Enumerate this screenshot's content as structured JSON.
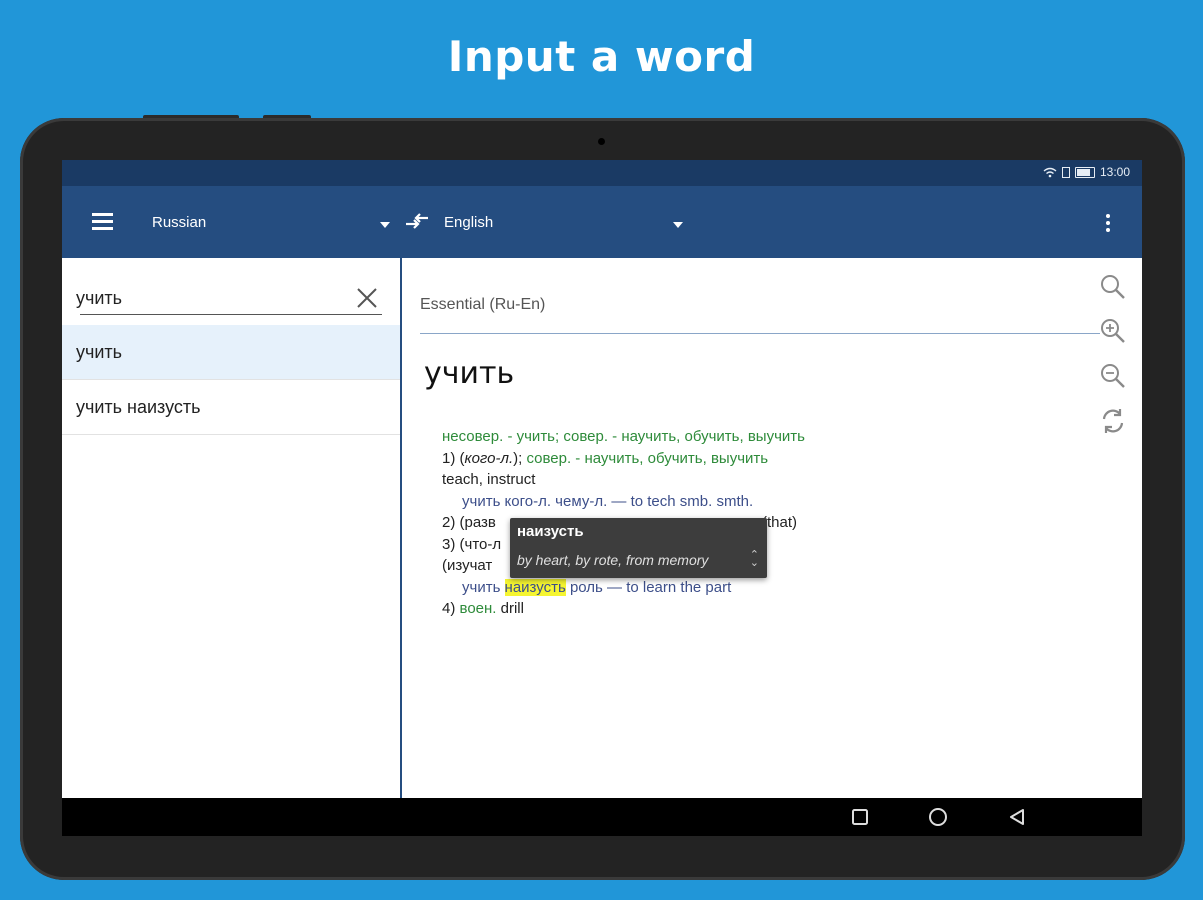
{
  "headline": "Input a word",
  "status": {
    "time": "13:00"
  },
  "toolbar": {
    "source_language": "Russian",
    "target_language": "English"
  },
  "search": {
    "query": "учить"
  },
  "suggestions": [
    {
      "label": "учить"
    },
    {
      "label": "учить наизусть"
    }
  ],
  "dictionary": {
    "name": "Essential (Ru-En)",
    "headword": "учить",
    "entry_lines": {
      "grammar": "несовер. - учить; совер. - научить, обучить, выучить",
      "s1_num": "1) (",
      "s1_obj": "кого-л.",
      "s1_close": ");",
      "s1_green": " совер. - научить, обучить, выучить",
      "s1_trans": "teach, instruct",
      "s1_ex": "учить кого-л. чему-л. — to tech smb. smth.",
      "s2_a": "2) (разв",
      "s2_b": "(that)",
      "s3_a": "3) (что-л",
      "s3_b": "(изучат",
      "ex4_pre": "учить ",
      "ex4_hl": "наизусть",
      "ex4_post": " роль — to learn the part",
      "s4_num": "4) ",
      "s4_label": "воен.",
      "s4_trans": " drill"
    }
  },
  "tooltip": {
    "word": "наизусть",
    "translation": "by heart, by rote, from memory"
  },
  "colors": {
    "background": "#2196d8",
    "toolbar": "#254d80",
    "statusbar": "#1a3a64",
    "grammar_green": "#2e8b3a",
    "highlight": "#f5f531"
  }
}
